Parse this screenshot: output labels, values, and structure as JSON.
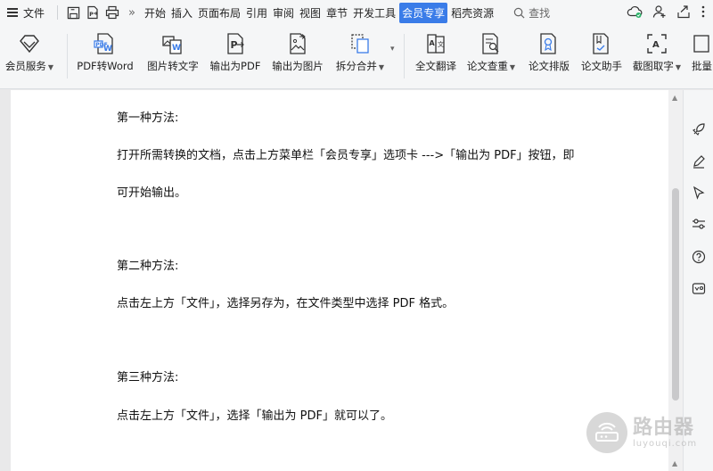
{
  "menubar": {
    "file_label": "文件",
    "tabs": [
      "开始",
      "插入",
      "页面布局",
      "引用",
      "审阅",
      "视图",
      "章节",
      "开发工具",
      "会员专享",
      "稻壳资源"
    ],
    "active_tab": "会员专享",
    "search_label": "查找",
    "more_chevron": "»"
  },
  "toolbar": {
    "items": [
      {
        "label": "会员服务",
        "icon": "diamond-icon",
        "dropdown": true
      },
      {
        "label": "PDF转Word",
        "icon": "pdf-to-word-icon",
        "dropdown": false
      },
      {
        "label": "图片转文字",
        "icon": "image-to-text-icon",
        "dropdown": false
      },
      {
        "label": "输出为PDF",
        "icon": "export-pdf-icon",
        "dropdown": false
      },
      {
        "label": "输出为图片",
        "icon": "export-image-icon",
        "dropdown": false
      },
      {
        "label": "拆分合并",
        "icon": "split-merge-icon",
        "dropdown": true
      },
      {
        "label": "全文翻译",
        "icon": "translate-icon",
        "dropdown": false
      },
      {
        "label": "论文查重",
        "icon": "paper-check-icon",
        "dropdown": true
      },
      {
        "label": "论文排版",
        "icon": "paper-format-icon",
        "dropdown": false
      },
      {
        "label": "论文助手",
        "icon": "paper-assistant-icon",
        "dropdown": false
      },
      {
        "label": "截图取字",
        "icon": "screenshot-ocr-icon",
        "dropdown": true
      },
      {
        "label": "批量",
        "icon": "batch-icon",
        "dropdown": false
      }
    ]
  },
  "document": {
    "paragraphs": [
      "第一种方法:",
      "打开所需转换的文档，点击上方菜单栏「会员专享」选项卡 --->「输出为 PDF」按钮，即",
      "可开始输出。",
      "第二种方法:",
      "点击左上方「文件」，选择另存为，在文件类型中选择 PDF 格式。",
      "第三种方法:",
      "点击左上方「文件」，选择「输出为 PDF」就可以了。"
    ]
  },
  "watermark": {
    "text_cn": "路由器",
    "text_en": "luyouqi.com"
  },
  "colors": {
    "accent": "#3a7ce8",
    "toolbar_bg": "#f5f6f7",
    "doc_bg": "#e9e9ea",
    "page_bg": "#ffffff"
  }
}
